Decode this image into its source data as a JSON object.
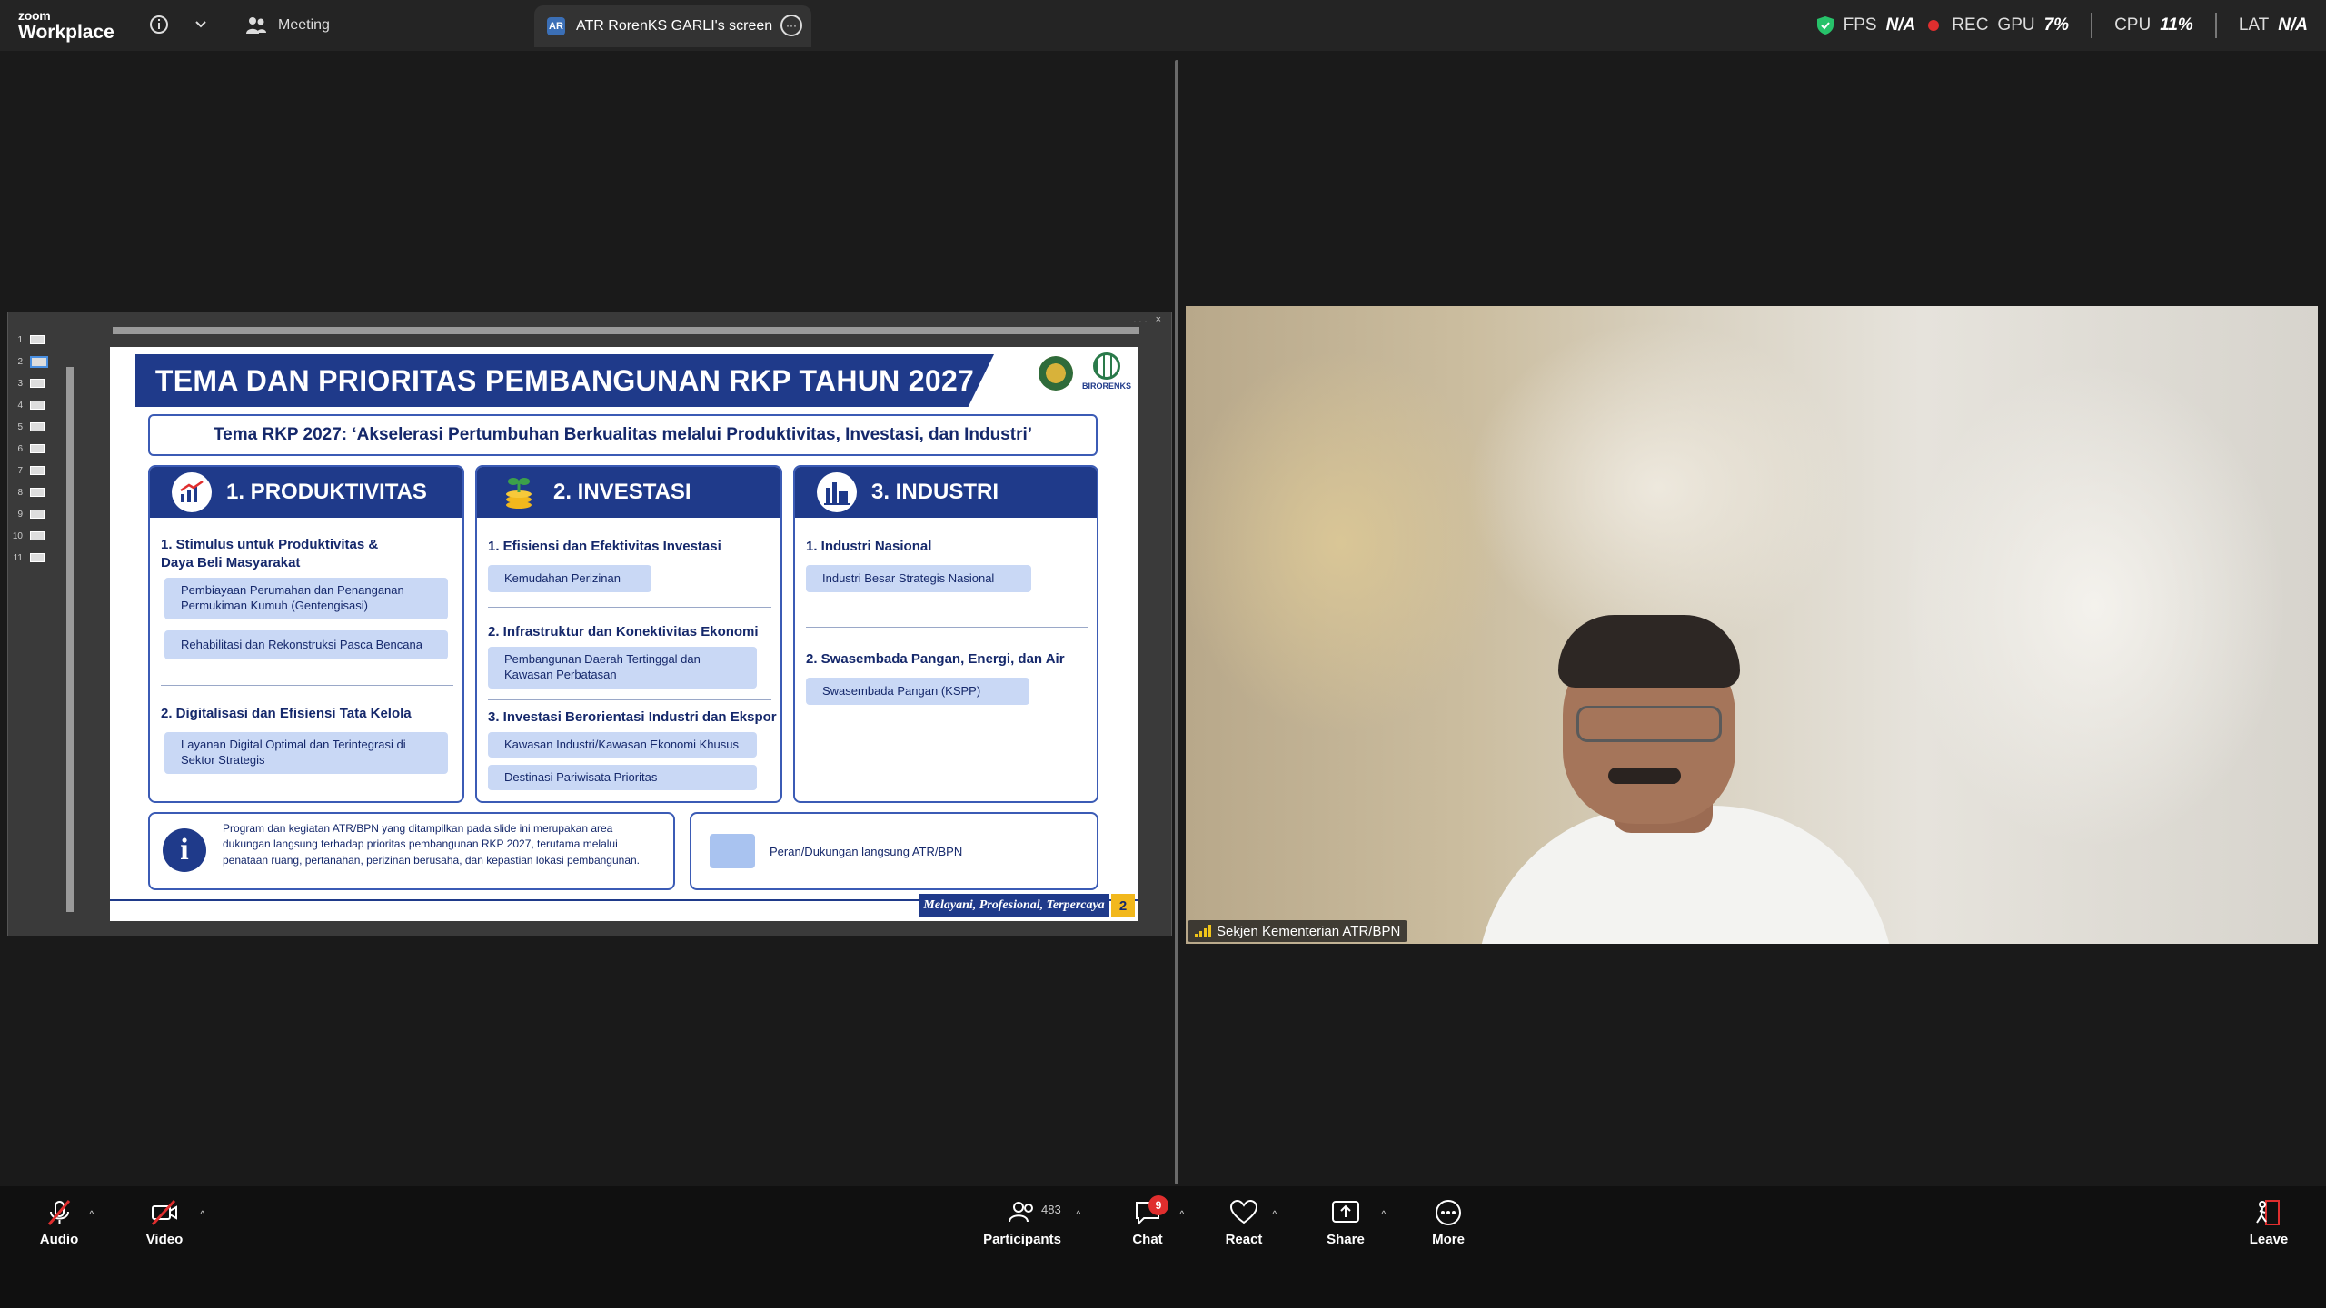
{
  "titlebar": {
    "logo_small": "zoom",
    "logo_big": "Workplace",
    "meeting_tab": "Meeting",
    "screen_tab_badge": "AR",
    "screen_tab": "ATR RorenKS GARLI's screen",
    "stats": {
      "fps_label": "FPS",
      "fps_value": "N/A",
      "rec_label": "REC",
      "gpu_label": "GPU",
      "gpu_value": "7%",
      "cpu_label": "CPU",
      "cpu_value": "11%",
      "lat_label": "LAT",
      "lat_value": "N/A"
    }
  },
  "ppt": {
    "window_ctrl": "... ×",
    "thumbnails": [
      "1",
      "2",
      "3",
      "4",
      "5",
      "6",
      "7",
      "8",
      "9",
      "10",
      "11"
    ],
    "active_thumbnail": 2
  },
  "slide": {
    "title": "TEMA DAN PRIORITAS PEMBANGUNAN RKP TAHUN 2027",
    "logo_text": "BIRORENKS",
    "theme": "Tema RKP 2027: ‘Akselerasi Pertumbuhan Berkualitas melalui Produktivitas, Investasi, dan Industri’",
    "columns": [
      {
        "title": "1. PRODUKTIVITAS",
        "icon": "chart-up-icon",
        "sections": [
          {
            "title": "1. Stimulus untuk Produktivitas &\n    Daya Beli Masyarakat",
            "items": [
              "Pembiayaan Perumahan dan Penanganan Permukiman Kumuh (Gentengisasi)",
              "Rehabilitasi dan Rekonstruksi Pasca Bencana"
            ]
          },
          {
            "title": "2. Digitalisasi dan Efisiensi Tata Kelola",
            "items": [
              "Layanan Digital Optimal dan Terintegrasi di Sektor Strategis"
            ]
          }
        ]
      },
      {
        "title": "2. INVESTASI",
        "icon": "coins-plant-icon",
        "sections": [
          {
            "title": "1. Efisiensi dan Efektivitas Investasi",
            "items": [
              "Kemudahan Perizinan"
            ]
          },
          {
            "title": "2. Infrastruktur dan Konektivitas Ekonomi",
            "items": [
              "Pembangunan Daerah Tertinggal dan Kawasan Perbatasan"
            ]
          },
          {
            "title": "3. Investasi Berorientasi Industri dan Ekspor",
            "items": [
              "Kawasan Industri/Kawasan Ekonomi Khusus",
              "Destinasi Pariwisata Prioritas"
            ]
          }
        ]
      },
      {
        "title": "3. INDUSTRI",
        "icon": "factory-icon",
        "sections": [
          {
            "title": "1. Industri Nasional",
            "items": [
              "Industri Besar Strategis Nasional"
            ]
          },
          {
            "title": "2. Swasembada Pangan, Energi, dan Air",
            "items": [
              "Swasembada Pangan (KSPP)"
            ]
          }
        ]
      }
    ],
    "note": "Program dan kegiatan ATR/BPN yang ditampilkan pada slide ini merupakan area dukungan langsung terhadap prioritas pembangunan RKP 2027, terutama melalui penataan ruang, pertanahan, perizinan berusaha, dan kepastian lokasi pembangunan.",
    "note_icon": "i",
    "legend": "Peran/Dukungan langsung ATR/BPN",
    "motto": "Melayani, Profesional, Terpercaya",
    "page_number": "2"
  },
  "video": {
    "participant_name": "Sekjen Kementerian ATR/BPN"
  },
  "toolbar": {
    "audio": "Audio",
    "video": "Video",
    "participants": "Participants",
    "participants_count": "483",
    "chat": "Chat",
    "chat_badge": "9",
    "react": "React",
    "share": "Share",
    "more": "More",
    "leave": "Leave"
  },
  "colors": {
    "slide_navy": "#1f3a8a",
    "pill_blue": "#c9d8f5",
    "badge_red": "#e02e2e",
    "shield_green": "#27c26a"
  }
}
